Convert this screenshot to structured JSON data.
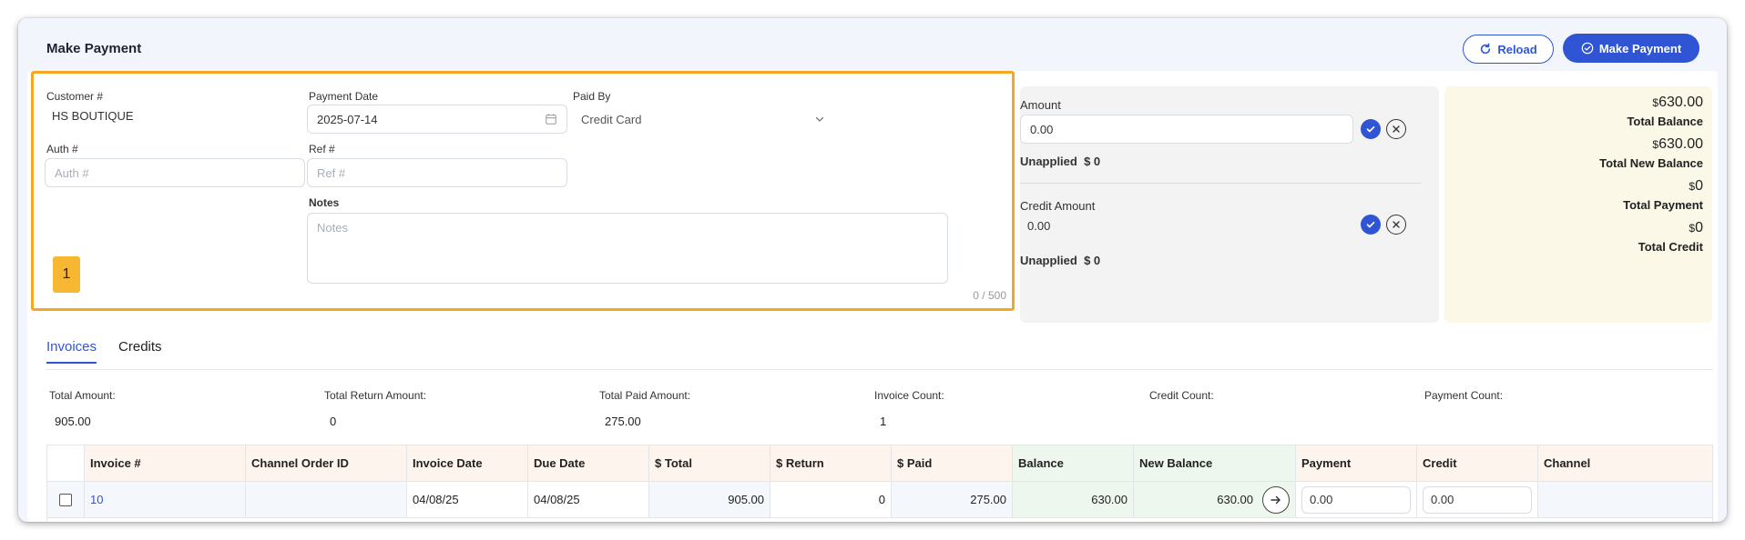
{
  "window": {
    "title": "Make Payment"
  },
  "toolbar": {
    "reload_label": "Reload",
    "make_payment_label": "Make Payment"
  },
  "form": {
    "customer_label": "Customer #",
    "customer_value": "HS BOUTIQUE",
    "payment_date_label": "Payment Date",
    "payment_date_value": "2025-07-14",
    "paid_by_label": "Paid By",
    "paid_by_value": "Credit Card",
    "auth_label": "Auth #",
    "auth_placeholder": "Auth #",
    "ref_label": "Ref #",
    "ref_placeholder": "Ref #",
    "notes_label": "Notes",
    "notes_placeholder": "Notes",
    "notes_count": "0 / 500",
    "step_badge": "1"
  },
  "amount": {
    "amount_label": "Amount",
    "amount_value": "0.00",
    "unapplied_label": "Unapplied",
    "unapplied_value": "$ 0",
    "credit_label": "Credit Amount",
    "credit_value": "0.00",
    "credit_unapplied_label": "Unapplied",
    "credit_unapplied_value": "$ 0"
  },
  "summary": {
    "items": [
      {
        "currency": "$",
        "value": "630.00",
        "label": "Total Balance"
      },
      {
        "currency": "$",
        "value": "630.00",
        "label": "Total New Balance"
      },
      {
        "currency": "$",
        "value": "0",
        "label": "Total Payment"
      },
      {
        "currency": "$",
        "value": "0",
        "label": "Total Credit"
      }
    ]
  },
  "tabs": [
    {
      "label": "Invoices",
      "active": true
    },
    {
      "label": "Credits",
      "active": false
    }
  ],
  "stats": [
    {
      "label": "Total Amount:",
      "value": "905.00"
    },
    {
      "label": "Total Return Amount:",
      "value": "0"
    },
    {
      "label": "Total Paid Amount:",
      "value": "275.00"
    },
    {
      "label": "Invoice Count:",
      "value": "1"
    },
    {
      "label": "Credit Count:",
      "value": ""
    },
    {
      "label": "Payment Count:",
      "value": ""
    }
  ],
  "table": {
    "headers": [
      "Invoice #",
      "Channel Order ID",
      "Invoice Date",
      "Due Date",
      "$ Total",
      "$ Return",
      "$ Paid",
      "Balance",
      "New Balance",
      "Payment",
      "Credit",
      "Channel"
    ],
    "rows": [
      {
        "invoice": "10",
        "channel_order_id": "",
        "invoice_date": "04/08/25",
        "due_date": "04/08/25",
        "total": "905.00",
        "return": "0",
        "paid": "275.00",
        "balance": "630.00",
        "new_balance": "630.00",
        "payment": "0.00",
        "credit": "0.00",
        "channel": ""
      }
    ]
  },
  "colors": {
    "accent": "#2f55d4",
    "highlight": "#f5a623",
    "summary_bg": "#fbf8e8"
  }
}
